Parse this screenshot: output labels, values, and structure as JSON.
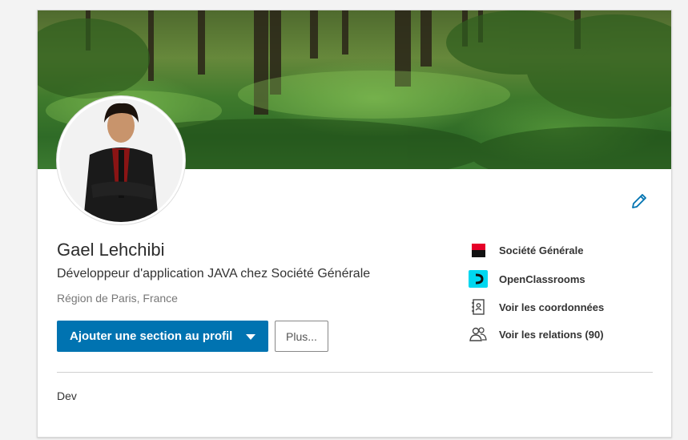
{
  "profile": {
    "name": "Gael Lehchibi",
    "headline": "Développeur d'application JAVA chez Société Générale",
    "location": "Région de Paris, France",
    "summary": "Dev"
  },
  "actions": {
    "add_section_label": "Ajouter une section au profil",
    "more_label": "Plus..."
  },
  "side_links": [
    {
      "label": "Société Générale",
      "icon": "societe-generale-logo"
    },
    {
      "label": "OpenClassrooms",
      "icon": "openclassrooms-logo"
    },
    {
      "label": "Voir les coordonnées",
      "icon": "contact-card-icon"
    },
    {
      "label": "Voir les relations (90)",
      "icon": "people-icon"
    }
  ],
  "colors": {
    "primary": "#0073b1",
    "banner": "#3f7a2c",
    "sg_red": "#e60028",
    "oc_cyan": "#00d7f0"
  }
}
